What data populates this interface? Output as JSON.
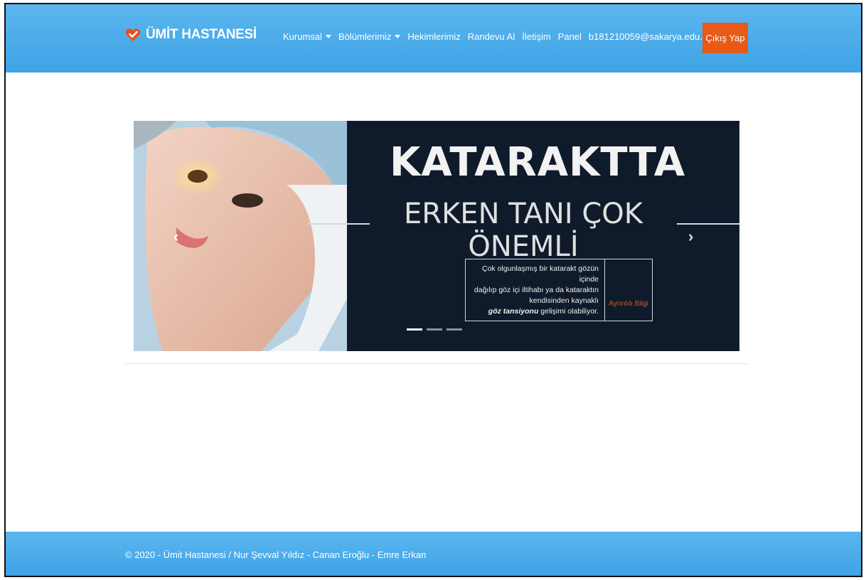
{
  "brand": {
    "name": "ÜMİT HASTANESİ",
    "icon": "heart-check-icon",
    "icon_color": "#e8501c"
  },
  "nav": {
    "items": [
      {
        "label": "Kurumsal",
        "dropdown": true
      },
      {
        "label": "Bölümlerimiz",
        "dropdown": true
      },
      {
        "label": "Hekimlerimiz",
        "dropdown": false
      },
      {
        "label": "Randevu Al",
        "dropdown": false
      },
      {
        "label": "İletişim",
        "dropdown": false
      },
      {
        "label": "Panel",
        "dropdown": false
      }
    ],
    "user_email": "b181210059@sakarya.edu.tr",
    "logout_label": "Çıkış Yap"
  },
  "carousel": {
    "headline": "KATARAKTTA",
    "subline": "ERKEN TANI ÇOK ÖNEMLİ",
    "info_lines": [
      "Çok olgunlaşmış bir katarakt gözün içinde",
      "dağılıp göz içi iltihabı ya da kataraktın",
      "kendisinden kaynaklı"
    ],
    "info_bold": "göz tansiyonu",
    "info_tail": " gelişimi olabiliyor.",
    "more_label": "Ayrıntılı Bilgi",
    "prev_icon": "chevron-left-icon",
    "next_icon": "chevron-right-icon",
    "slides_count": 3,
    "active_index": 0
  },
  "footer": {
    "text": "© 2020 - Ümit Hastanesi / Nur Şevval Yıldız - Canan Eroğlu - Emre Erkan"
  },
  "colors": {
    "nav_bg": "#4aacea",
    "logout_bg": "#e85a15",
    "slide_bg": "#0f1b2b",
    "accent": "#d2552a"
  }
}
